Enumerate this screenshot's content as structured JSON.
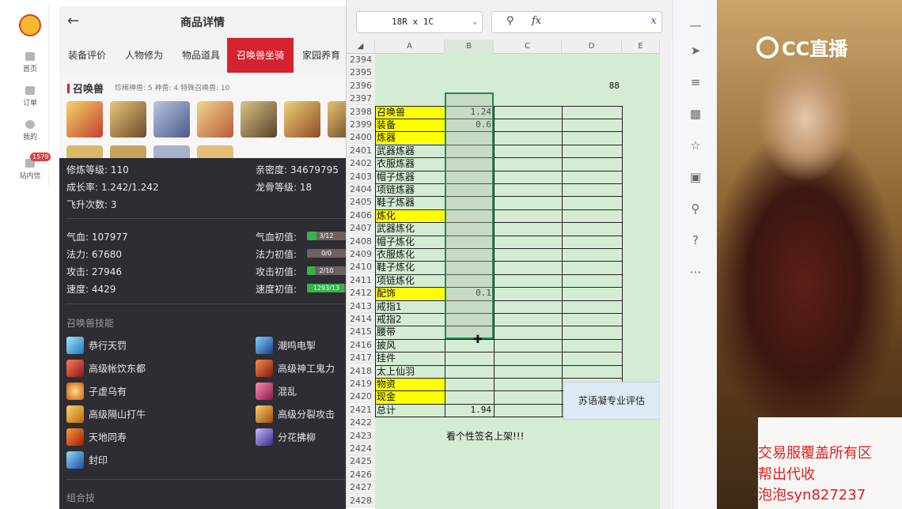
{
  "app_sidebar": {
    "items": [
      {
        "label": "首页",
        "icon": "home-icon"
      },
      {
        "label": "订单",
        "icon": "order-icon"
      },
      {
        "label": "我的",
        "icon": "user-icon"
      },
      {
        "label": "站内信",
        "icon": "mail-icon",
        "badge": "1579"
      }
    ]
  },
  "product": {
    "title": "商品详情",
    "tabs": [
      "装备评价",
      "人物修为",
      "物品道具",
      "召唤兽坐骑",
      "家园养育"
    ],
    "active_tab": "召唤兽坐骑",
    "summon_header": "召唤兽",
    "summon_sub": "珍稀神兽: 5   神兽: 4   特殊召唤兽: 10",
    "stats_rows": [
      {
        "left": "修炼等级: 110",
        "right": "亲密度: 34679795"
      },
      {
        "left": "成长率: 1.242/1.242",
        "right": "龙骨等级: 18"
      },
      {
        "left": "飞升次数: 3",
        "right": ""
      }
    ],
    "attrs": [
      {
        "left": "气血: 107977",
        "right": "气血初值:",
        "bar": "3/12",
        "fill": 0.25
      },
      {
        "left": "法力: 67680",
        "right": "法力初值:",
        "bar": "0/0",
        "fill": 0
      },
      {
        "left": "攻击: 27946",
        "right": "攻击初值:",
        "bar": "2/10",
        "fill": 0.2
      },
      {
        "left": "速度: 4429",
        "right": "速度初值:",
        "bar": "1293/13",
        "fill": 0.95
      }
    ],
    "skills_title": "召唤兽技能",
    "skills_left": [
      "恭行天罚",
      "高级帐饮东都",
      "子虚乌有",
      "高级隔山打牛",
      "天地同寿",
      "封印"
    ],
    "skills_right": [
      "潮鸣电掣",
      "高级神工鬼力",
      "混乱",
      "高级分裂攻击",
      "分花拂柳"
    ],
    "combo_title": "组合技"
  },
  "excel": {
    "namebox": "18R x 1C",
    "columns": [
      "A",
      "B",
      "C",
      "D",
      "E"
    ],
    "rows": [
      {
        "n": "2394",
        "a": "",
        "b": ""
      },
      {
        "n": "2395",
        "a": "",
        "b": ""
      },
      {
        "n": "2396",
        "a": "",
        "b": "",
        "d": "88"
      },
      {
        "n": "2397",
        "a": "",
        "b": ""
      },
      {
        "n": "2398",
        "a": "召唤兽",
        "b": "1.24",
        "yellow": true
      },
      {
        "n": "2399",
        "a": "装备",
        "b": "0.6",
        "yellow": true
      },
      {
        "n": "2400",
        "a": "炼器",
        "b": "",
        "yellow": true
      },
      {
        "n": "2401",
        "a": "武器炼器",
        "b": ""
      },
      {
        "n": "2402",
        "a": "衣服炼器",
        "b": ""
      },
      {
        "n": "2403",
        "a": "帽子炼器",
        "b": ""
      },
      {
        "n": "2404",
        "a": "项链炼器",
        "b": ""
      },
      {
        "n": "2405",
        "a": "鞋子炼器",
        "b": ""
      },
      {
        "n": "2406",
        "a": "炼化",
        "b": "",
        "yellow": true
      },
      {
        "n": "2407",
        "a": "武器炼化",
        "b": ""
      },
      {
        "n": "2408",
        "a": "帽子炼化",
        "b": ""
      },
      {
        "n": "2409",
        "a": "衣服炼化",
        "b": ""
      },
      {
        "n": "2410",
        "a": "鞋子炼化",
        "b": ""
      },
      {
        "n": "2411",
        "a": "项链炼化",
        "b": ""
      },
      {
        "n": "2412",
        "a": "配饰",
        "b": "0.1",
        "yellow": true
      },
      {
        "n": "2413",
        "a": "戒指1",
        "b": ""
      },
      {
        "n": "2414",
        "a": "戒指2",
        "b": ""
      },
      {
        "n": "2415",
        "a": "腰带",
        "b": ""
      },
      {
        "n": "2416",
        "a": "披风",
        "b": ""
      },
      {
        "n": "2417",
        "a": "挂件",
        "b": ""
      },
      {
        "n": "2418",
        "a": "太上仙羽",
        "b": ""
      },
      {
        "n": "2419",
        "a": "物资",
        "b": "",
        "yellow": true
      },
      {
        "n": "2420",
        "a": "现金",
        "b": "",
        "yellow": true
      },
      {
        "n": "2421",
        "a": "总计",
        "b": "1.94"
      },
      {
        "n": "2422",
        "a": "",
        "b": ""
      },
      {
        "n": "2423",
        "a": "",
        "b": "看个性签名上架!!!"
      },
      {
        "n": "2424",
        "a": "",
        "b": ""
      },
      {
        "n": "2425",
        "a": "",
        "b": ""
      },
      {
        "n": "2426",
        "a": "",
        "b": ""
      },
      {
        "n": "2427",
        "a": "",
        "b": ""
      },
      {
        "n": "2428",
        "a": "",
        "b": ""
      }
    ],
    "side_box": "苏语凝专业评估"
  },
  "stream": {
    "logo": "CC直播",
    "ad_lines": [
      "交易服覆盖所有区",
      "帮出代收",
      "泡泡syn827237"
    ]
  },
  "colors": {
    "accent": "#d4232e",
    "sheet_bg": "#d4ecd3",
    "highlight": "#ffff00",
    "selection": "#1e8b4c",
    "ad_text": "#e0201e"
  }
}
